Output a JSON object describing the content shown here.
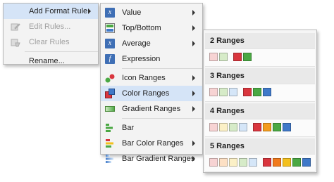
{
  "menu1": {
    "items": [
      {
        "label": "Add Format Rule",
        "highlighted": true,
        "submenu": true,
        "disabled": false,
        "icon": "none"
      },
      {
        "label": "Edit Rules...",
        "disabled": true,
        "icon": "edit-rules-icon"
      },
      {
        "label": "Clear Rules",
        "disabled": true,
        "icon": "clear-rules-icon"
      },
      {
        "label": "Rename...",
        "disabled": false,
        "icon": "none"
      }
    ]
  },
  "menu2": {
    "items": [
      {
        "label": "Value",
        "icon": "value-fx-icon",
        "submenu": true
      },
      {
        "label": "Top/Bottom",
        "icon": "top-bottom-icon",
        "submenu": true
      },
      {
        "label": "Average",
        "icon": "average-fx-icon",
        "submenu": true
      },
      {
        "label": "Expression",
        "icon": "expression-fx-icon",
        "submenu": false
      },
      {
        "label": "Icon Ranges",
        "icon": "icon-ranges-icon",
        "submenu": true
      },
      {
        "label": "Color Ranges",
        "icon": "color-ranges-icon",
        "submenu": true,
        "highlighted": true
      },
      {
        "label": "Gradient Ranges",
        "icon": "gradient-ranges-icon",
        "submenu": true
      },
      {
        "label": "Bar",
        "icon": "bar-icon",
        "submenu": false
      },
      {
        "label": "Bar Color Ranges",
        "icon": "bar-color-ranges-icon",
        "submenu": true
      },
      {
        "label": "Bar Gradient Ranges",
        "icon": "bar-gradient-ranges-icon",
        "submenu": true
      }
    ]
  },
  "menu3": {
    "sections": [
      {
        "title": "2 Ranges",
        "light": [
          "#f7d3d3",
          "#d6ebc8"
        ],
        "dark": [
          "#d9363e",
          "#4aa843"
        ]
      },
      {
        "title": "3 Ranges",
        "light": [
          "#f7d3d3",
          "#d6ebc8",
          "#d5e6f8"
        ],
        "dark": [
          "#d9363e",
          "#4aa843",
          "#3f79c9"
        ]
      },
      {
        "title": "4 Ranges",
        "light": [
          "#f7d3d3",
          "#fbf0c6",
          "#d6ebc8",
          "#d5e6f8"
        ],
        "dark": [
          "#d9363e",
          "#f39c1e",
          "#4aa843",
          "#3f79c9"
        ]
      },
      {
        "title": "5 Ranges",
        "light": [
          "#f7d3d3",
          "#fde0c4",
          "#fbf0c6",
          "#d6ebc8",
          "#d5e6f8"
        ],
        "dark": [
          "#d9363e",
          "#f07a1c",
          "#f3c01e",
          "#4aa843",
          "#3f79c9"
        ]
      }
    ]
  },
  "colors": {
    "highlight": "#d5e4f7",
    "menu_bg": "#f3f3f3",
    "border": "#b9b9b9"
  }
}
